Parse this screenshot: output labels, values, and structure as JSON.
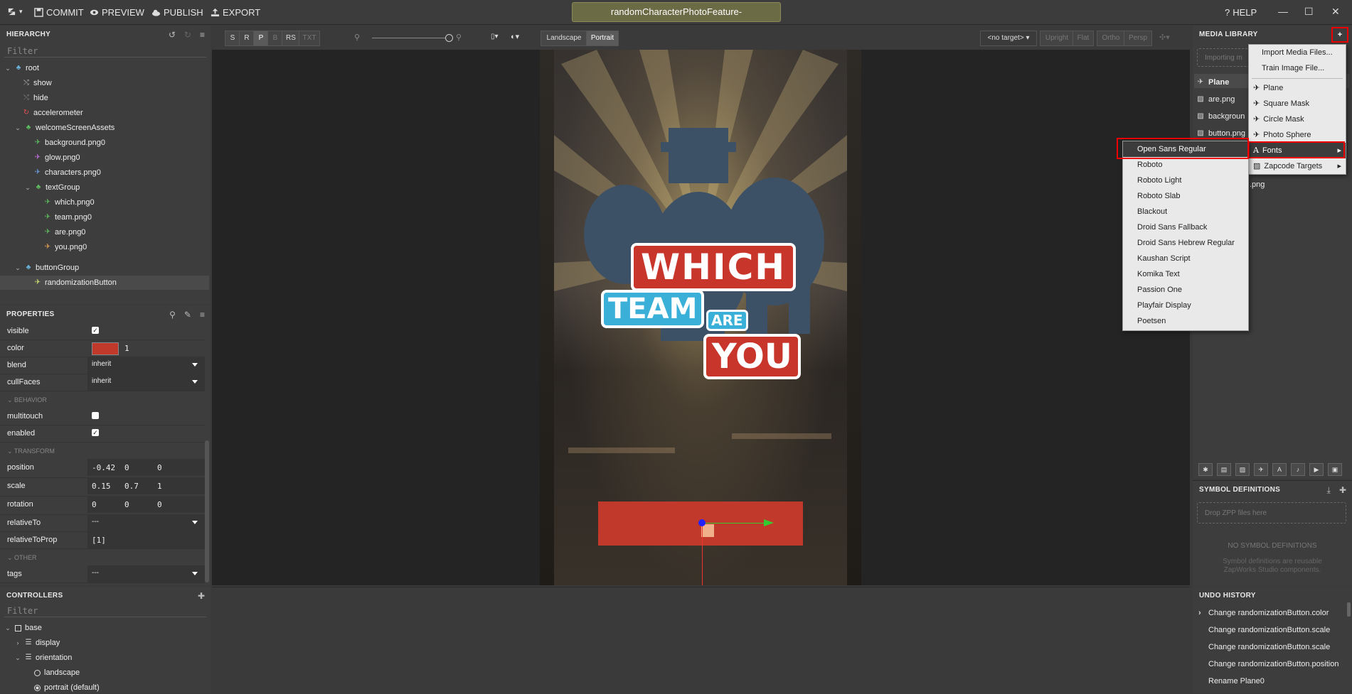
{
  "topbar": {
    "commit": "COMMIT",
    "preview": "PREVIEW",
    "publish": "PUBLISH",
    "export": "EXPORT",
    "title": "randomCharacterPhotoFeature-",
    "help": "HELP"
  },
  "hierarchy": {
    "title": "HIERARCHY",
    "filter_placeholder": "Filter",
    "items": [
      {
        "label": "root"
      },
      {
        "label": "show"
      },
      {
        "label": "hide"
      },
      {
        "label": "accelerometer"
      },
      {
        "label": "welcomeScreenAssets"
      },
      {
        "label": "background.png0"
      },
      {
        "label": "glow.png0"
      },
      {
        "label": "characters.png0"
      },
      {
        "label": "textGroup"
      },
      {
        "label": "which.png0"
      },
      {
        "label": "team.png0"
      },
      {
        "label": "are.png0"
      },
      {
        "label": "you.png0"
      },
      {
        "label": "buttonGroup"
      },
      {
        "label": "randomizationButton"
      }
    ]
  },
  "properties": {
    "title": "PROPERTIES",
    "visible": "visible",
    "color": "color",
    "color_value": "#c0392b",
    "color_alpha": "1",
    "blend": "blend",
    "blend_value": "inherit",
    "cullFaces": "cullFaces",
    "cullFaces_value": "inherit",
    "behavior_section": "BEHAVIOR",
    "multitouch": "multitouch",
    "enabled": "enabled",
    "transform_section": "TRANSFORM",
    "position": "position",
    "position_values": [
      "-0.42",
      "0",
      "0"
    ],
    "scale": "scale",
    "scale_values": [
      "0.15",
      "0.7",
      "1"
    ],
    "rotation": "rotation",
    "rotation_values": [
      "0",
      "0",
      "0"
    ],
    "relativeTo": "relativeTo",
    "relativeTo_value": "---",
    "relativeToProp": "relativeToProp",
    "relativeToProp_value": "[1]",
    "other_section": "OTHER",
    "tags": "tags",
    "tags_value": "---"
  },
  "controllers": {
    "title": "CONTROLLERS",
    "filter_placeholder": "Filter",
    "items": [
      {
        "label": "base"
      },
      {
        "label": "display"
      },
      {
        "label": "orientation"
      },
      {
        "label": "landscape"
      },
      {
        "label": "portrait (default)"
      }
    ]
  },
  "viewport": {
    "modes": [
      "S",
      "R",
      "P",
      "B",
      "RS",
      "TXT"
    ],
    "landscape": "Landscape",
    "portrait": "Portrait",
    "target": "<no target>",
    "upright": "Upright",
    "flat": "Flat",
    "ortho": "Ortho",
    "persp": "Persp",
    "text_which": "WHICH",
    "text_team": "TEAM",
    "text_are": "ARE",
    "text_you": "YOU"
  },
  "media_library": {
    "title": "MEDIA LIBRARY",
    "importing": "Importing m",
    "items": [
      {
        "label": "Plane"
      },
      {
        "label": "are.png"
      },
      {
        "label": "backgroun"
      },
      {
        "label": "button.png"
      },
      {
        "label": ".png"
      }
    ]
  },
  "add_menu": {
    "items": [
      {
        "label": "Import Media Files..."
      },
      {
        "label": "Train Image File..."
      },
      {
        "label": "Plane"
      },
      {
        "label": "Square Mask"
      },
      {
        "label": "Circle Mask"
      },
      {
        "label": "Photo Sphere"
      },
      {
        "label": "Fonts"
      },
      {
        "label": "Zapcode Targets"
      }
    ]
  },
  "fonts_menu": {
    "items": [
      {
        "label": "Open Sans Regular"
      },
      {
        "label": "Roboto"
      },
      {
        "label": "Roboto Light"
      },
      {
        "label": "Roboto Slab"
      },
      {
        "label": "Blackout"
      },
      {
        "label": "Droid Sans Fallback"
      },
      {
        "label": "Droid Sans Hebrew Regular"
      },
      {
        "label": "Kaushan Script"
      },
      {
        "label": "Komika Text"
      },
      {
        "label": "Passion One"
      },
      {
        "label": "Playfair Display"
      },
      {
        "label": "Poetsen"
      }
    ]
  },
  "symbol_definitions": {
    "title": "SYMBOL DEFINITIONS",
    "drop": "Drop ZPP files here",
    "empty": "NO SYMBOL DEFINITIONS",
    "hint": "Symbol definitions are reusable ZapWorks Studio components."
  },
  "undo_history": {
    "title": "UNDO HISTORY",
    "items": [
      {
        "label": "Change randomizationButton.color"
      },
      {
        "label": "Change randomizationButton.scale"
      },
      {
        "label": "Change randomizationButton.scale"
      },
      {
        "label": "Change randomizationButton.position"
      },
      {
        "label": "Rename Plane0"
      }
    ]
  }
}
